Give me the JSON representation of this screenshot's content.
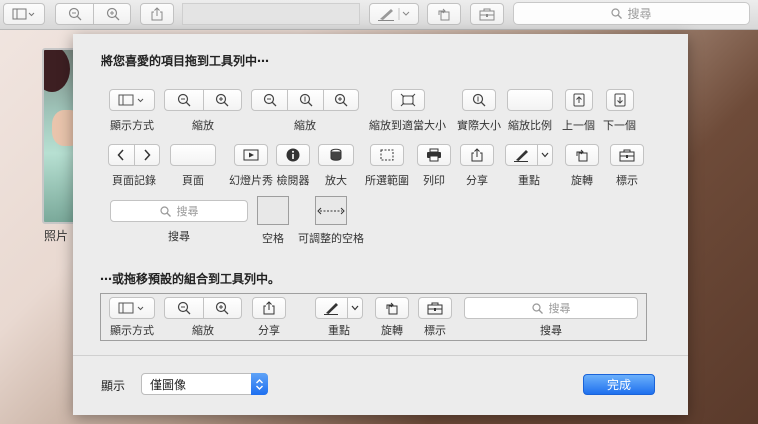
{
  "window_toolbar": {
    "search_placeholder": "搜尋"
  },
  "sidebar": {
    "thumbnail_label": "照片"
  },
  "sheet": {
    "heading_items": "將您喜愛的項目拖到工具列中⋯",
    "heading_default": "⋯或拖移預設的組合到工具列中。",
    "items": {
      "view": "顯示方式",
      "zoom_single": "縮放",
      "zoom_triple": "縮放",
      "zoom_fit": "縮放到適當大小",
      "actual_size": "實際大小",
      "scale": "縮放比例",
      "previous": "上一個",
      "next": "下一個",
      "page_nav": "頁面記錄",
      "page": "頁面",
      "slideshow": "幻燈片秀",
      "inspector": "檢閱器",
      "magnify": "放大",
      "selection": "所選範圍",
      "print": "列印",
      "share": "分享",
      "highlight": "重點",
      "rotate": "旋轉",
      "markup": "標示",
      "search": "搜尋",
      "search_placeholder": "搜尋",
      "space": "空格",
      "flex_space": "可調整的空格"
    },
    "default_set": {
      "view": "顯示方式",
      "zoom": "縮放",
      "share": "分享",
      "highlight": "重點",
      "rotate": "旋轉",
      "markup": "標示",
      "search": "搜尋",
      "search_placeholder": "搜尋"
    },
    "show_label": "顯示",
    "show_value": "僅圖像",
    "done_button": "完成"
  },
  "colors": {
    "accent": "#1f70ee"
  }
}
